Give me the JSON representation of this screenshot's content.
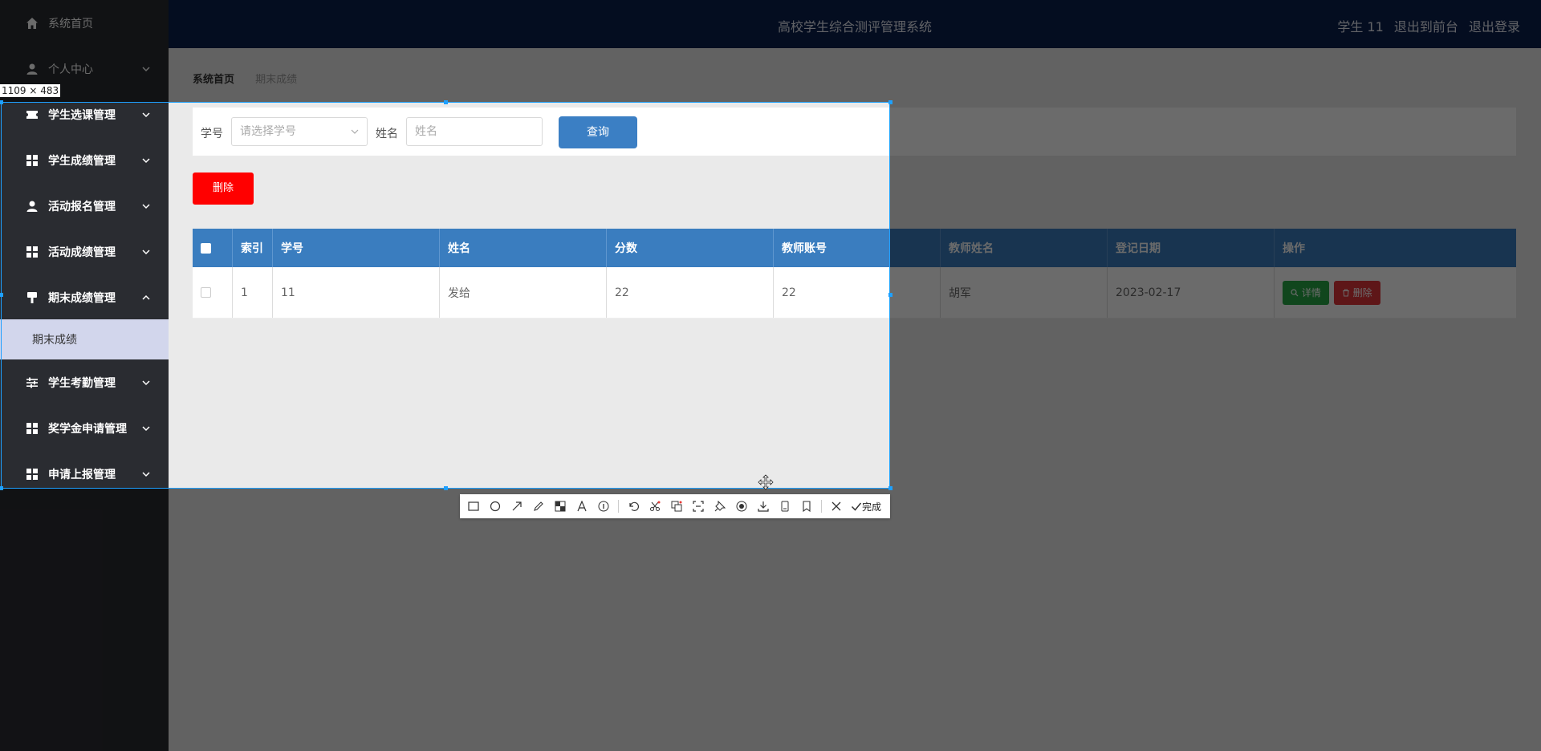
{
  "sidebar": {
    "items": [
      {
        "label": "系统首页",
        "icon": "home-icon"
      },
      {
        "label": "个人中心",
        "icon": "user-icon"
      },
      {
        "label": "学生选课管理",
        "icon": "ticket-icon"
      },
      {
        "label": "学生成绩管理",
        "icon": "grid-icon"
      },
      {
        "label": "活动报名管理",
        "icon": "user-icon"
      },
      {
        "label": "活动成绩管理",
        "icon": "grid-icon"
      },
      {
        "label": "期末成绩管理",
        "icon": "brush-icon"
      },
      {
        "label": "学生考勤管理",
        "icon": "sliders-icon"
      },
      {
        "label": "奖学金申请管理",
        "icon": "grid-icon"
      },
      {
        "label": "申请上报管理",
        "icon": "grid-icon"
      }
    ],
    "active_sub": "期末成绩"
  },
  "header": {
    "title": "高校学生综合测评管理系统",
    "user": "学生 11",
    "to_front": "退出到前台",
    "logout": "退出登录"
  },
  "breadcrumb": {
    "home": "系统首页",
    "current": "期末成绩"
  },
  "search": {
    "student_no_label": "学号",
    "student_no_placeholder": "请选择学号",
    "name_label": "姓名",
    "name_placeholder": "姓名",
    "query_button": "查询"
  },
  "actions": {
    "delete_button": "删除"
  },
  "table": {
    "headers": [
      "索引",
      "学号",
      "姓名",
      "分数",
      "教师账号",
      "教师姓名",
      "登记日期",
      "操作"
    ],
    "rows": [
      {
        "index": "1",
        "student_no": "11",
        "name": "发给",
        "score": "22",
        "teacher_account": "22",
        "teacher_name": "胡军",
        "date": "2023-02-17",
        "detail": "详情",
        "delete": "删除"
      }
    ]
  },
  "screenshot_tool": {
    "size_label": "1109 × 483",
    "done_label": "完成",
    "tools": [
      "rectangle-icon",
      "ellipse-icon",
      "arrow-icon",
      "pencil-icon",
      "mosaic-icon",
      "text-icon",
      "number-icon",
      "undo-icon",
      "scissors-icon",
      "translate-icon",
      "ocr-icon",
      "pin-icon",
      "record-icon",
      "download-icon",
      "long-screenshot-icon",
      "bookmark-icon",
      "close-icon",
      "check-icon"
    ]
  },
  "colors": {
    "sidebar_bg": "#2a2c31",
    "header_bg": "#0a1f4e",
    "table_header_bg": "#3a7dbf",
    "delete_red": "#ff0000",
    "detail_green": "#28a745",
    "selection_border": "#1ea0ff"
  }
}
